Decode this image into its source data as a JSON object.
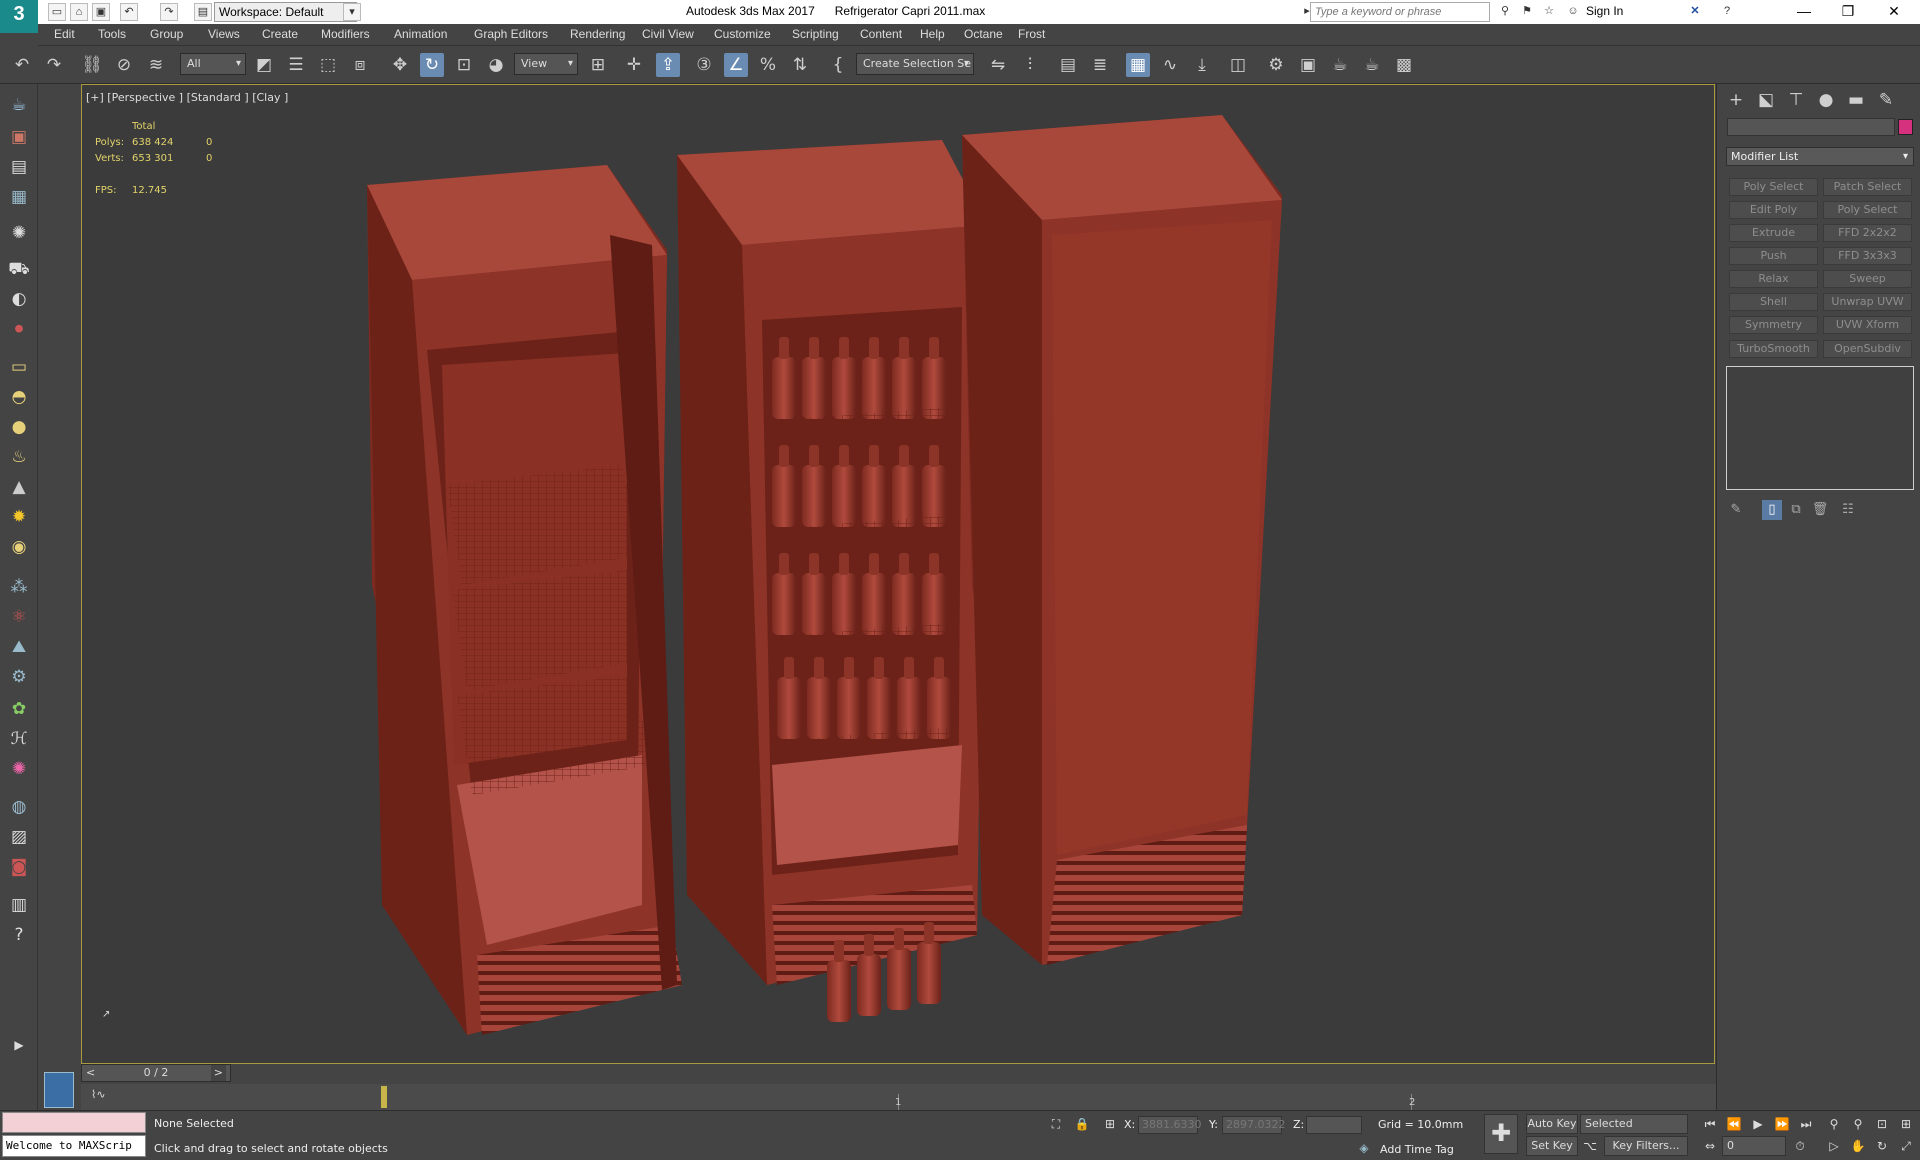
{
  "titlebar": {
    "logo_text": "3",
    "workspace_label": "Workspace: Default",
    "app_title": "Autodesk 3ds Max 2017      Refrigerator Capri 2011.max",
    "search_placeholder": "Type a keyword or phrase",
    "signin_label": "Sign In",
    "window_controls": [
      "minimize-icon",
      "maximize-icon",
      "close-icon"
    ]
  },
  "menubar": {
    "items": [
      "Edit",
      "Tools",
      "Group",
      "Views",
      "Create",
      "Modifiers",
      "Animation",
      "Graph Editors",
      "Rendering",
      "Civil View",
      "Customize",
      "Scripting",
      "Content",
      "Help",
      "Octane",
      "Frost"
    ]
  },
  "toolbar": {
    "filter_label": "All",
    "view_label": "View",
    "selection_set_label": "Create Selection Se"
  },
  "viewport": {
    "label": "[+] [Perspective ] [Standard ] [Clay ]",
    "stats": {
      "total_label": "Total",
      "polys_label": "Polys:",
      "polys_value": "638 424",
      "polys_selected": "0",
      "verts_label": "Verts:",
      "verts_value": "653 301",
      "verts_selected": "0",
      "fps_label": "FPS:",
      "fps_value": "12.745"
    },
    "object_color": "#9c3a2e",
    "selection_border_color": "#a99a3d"
  },
  "command_panel": {
    "modifier_list_label": "Modifier List",
    "modifier_buttons": [
      [
        "Poly Select",
        "Patch Select"
      ],
      [
        "Edit Poly",
        "Poly Select"
      ],
      [
        "Extrude",
        "FFD 2x2x2"
      ],
      [
        "Push",
        "FFD 3x3x3"
      ],
      [
        "Relax",
        "Sweep"
      ],
      [
        "Shell",
        "Unwrap UVW"
      ],
      [
        "Symmetry",
        "UVW Xform"
      ],
      [
        "TurboSmooth",
        "OpenSubdiv"
      ]
    ],
    "object_color": "#d6317f"
  },
  "timeline": {
    "frame_display": "0 / 2",
    "track_numbers": [
      "1",
      "2"
    ]
  },
  "statusbar": {
    "maxscript_text": "Welcome to MAXScrip",
    "selection_status": "None Selected",
    "prompt": "Click and drag to select and rotate objects",
    "x_label": "X:",
    "x_value": "3881.6330",
    "y_label": "Y:",
    "y_value": "2897.0322",
    "z_label": "Z:",
    "grid_label": "Grid = 10.0mm",
    "add_time_tag": "Add Time Tag",
    "auto_key": "Auto Key",
    "selected_label": "Selected",
    "set_key": "Set Key",
    "key_filters": "Key Filters...",
    "current_frame": "0"
  }
}
